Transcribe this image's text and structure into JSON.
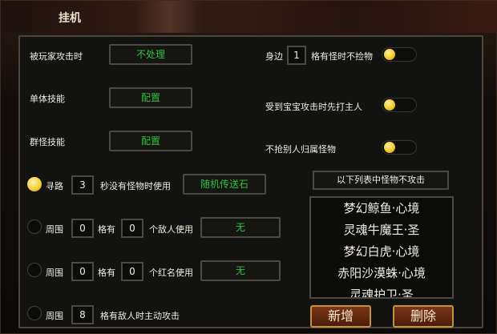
{
  "window": {
    "title": "挂机"
  },
  "left": {
    "attacked_label": "被玩家攻击时",
    "attacked_value": "不处理",
    "single_skill_label": "单体技能",
    "single_skill_btn": "配置",
    "group_skill_label": "群怪技能",
    "group_skill_btn": "配置",
    "pathing": {
      "label": "寻路",
      "value": "3",
      "suffix": "秒没有怪物时使用",
      "item": "随机传送石",
      "selected": true
    },
    "enemy_range": {
      "prefix": "周围",
      "value": "0",
      "mid": "格有",
      "count": "0",
      "suffix": "个敌人使用",
      "item": "无",
      "selected": false
    },
    "redname_range": {
      "prefix": "周围",
      "value": "0",
      "mid": "格有",
      "count": "0",
      "suffix": "个红名使用",
      "item": "无",
      "selected": false
    },
    "auto_attack": {
      "prefix": "周围",
      "value": "8",
      "suffix": "格有敌人时主动攻击",
      "selected": false
    }
  },
  "right": {
    "nearby": {
      "prefix": "身边",
      "value": "1",
      "suffix": "格有怪时不捡物",
      "toggle": true
    },
    "pet_attack": {
      "label": "受到宝宝攻击时先打主人",
      "toggle": true
    },
    "no_steal": {
      "label": "不抢别人归属怪物",
      "toggle": true
    },
    "list_header": "以下列表中怪物不攻击",
    "monsters": [
      "梦幻鲸鱼·心境",
      "灵魂牛魔王·圣",
      "梦幻白虎·心境",
      "赤阳沙漠蛛·心境",
      "灵魂护卫·圣"
    ],
    "add_button": "新增",
    "delete_button": "删除"
  },
  "colors": {
    "accent_green": "#2fc43a",
    "toggle_yellow": "#f3c51a",
    "action_gold": "#c4913b"
  }
}
